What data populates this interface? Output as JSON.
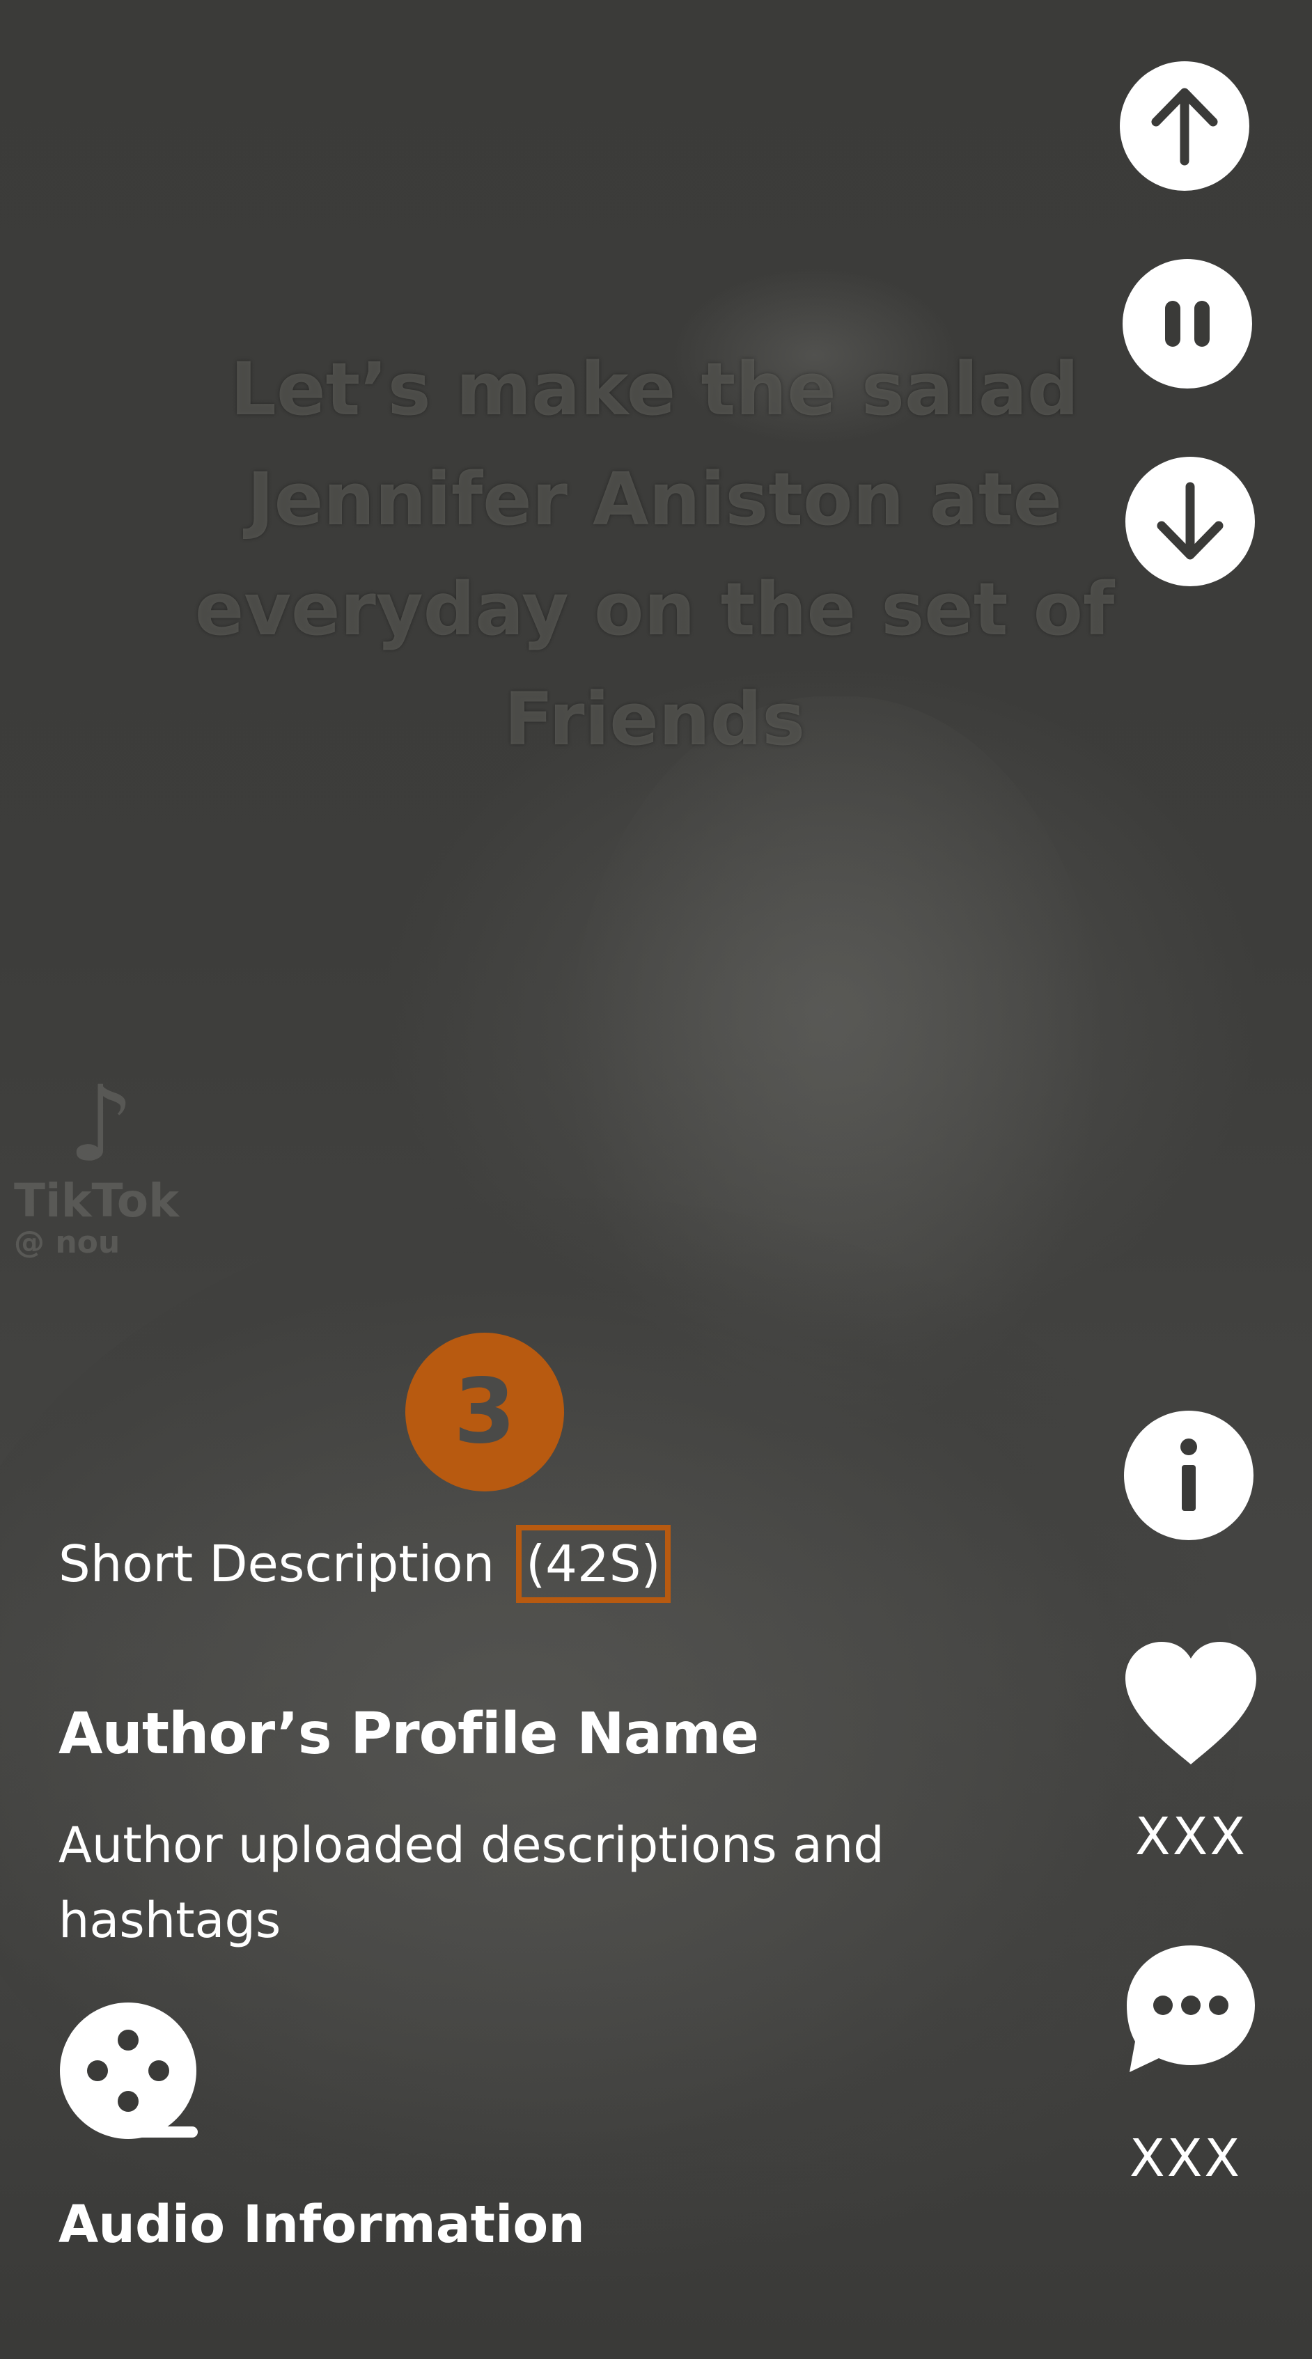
{
  "video": {
    "caption": "Let’s make the salad Jennifer Aniston ate everyday on the set of Friends",
    "watermark": {
      "brand": "TikTok",
      "handle": "@ nou"
    }
  },
  "controls": {
    "up_icon": "arrow-up-icon",
    "pause_icon": "pause-icon",
    "down_icon": "arrow-down-icon",
    "info_icon": "info-icon"
  },
  "actions": {
    "like_icon": "heart-icon",
    "like_count": "XXX",
    "comment_icon": "comment-bubble-icon",
    "comment_count": "XXX"
  },
  "annotation": {
    "step_number": "3",
    "color": "#b85a10"
  },
  "post": {
    "short_description_label": "Short Description",
    "duration": "(42S)",
    "author_name": "Author’s Profile Name",
    "author_description": "Author uploaded descriptions and hashtags",
    "audio_icon": "film-reel-icon",
    "audio_label": "Audio Information"
  }
}
